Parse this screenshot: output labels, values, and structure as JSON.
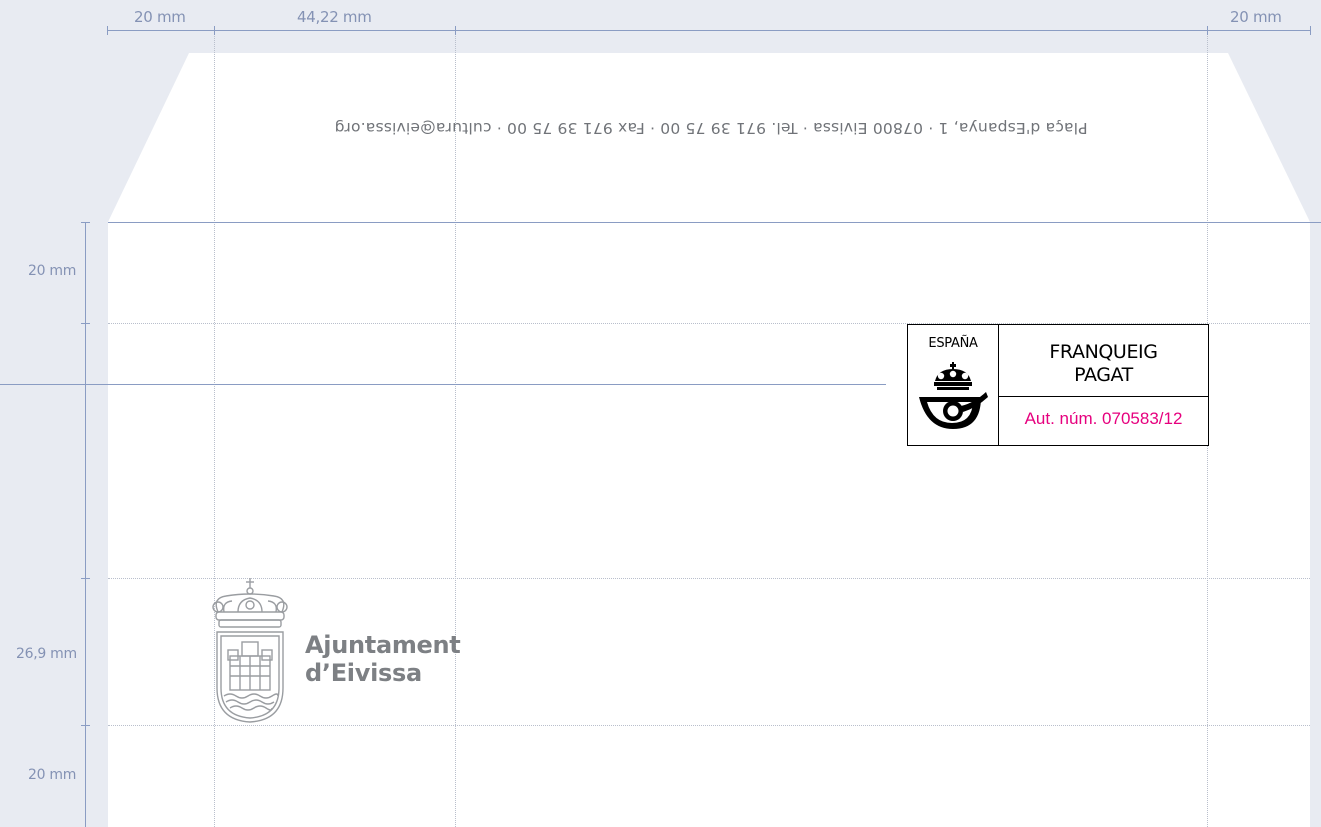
{
  "dimensions": {
    "top_left_margin": "20 mm",
    "top_logo_width": "44,22 mm",
    "top_right_margin": "20 mm",
    "side_top_margin": "20 mm",
    "side_logo_height": "26,9 mm",
    "side_bottom_margin": "20 mm"
  },
  "flap": {
    "address_line": "Plaça d'Espanya, 1 · 07800 Eivissa · Tel. 971 39 75 00 · Fax 971 39 75 00 · cultura@eivissa.org"
  },
  "postage": {
    "country": "ESPAÑA",
    "label_line1": "FRANQUEIG",
    "label_line2": "PAGAT",
    "authorization": "Aut. núm. 070583/12",
    "accent_color": "#e6007e",
    "icon": "correos-crown-horn-icon"
  },
  "logo": {
    "icon": "coat-of-arms-icon",
    "name_line1": "Ajuntament",
    "name_line2": "d’Eivissa",
    "color": "#7d8084"
  },
  "colors": {
    "background": "#e8ebf2",
    "dimension_lines": "#8a9cc3",
    "guide_lines": "#b9bfcc"
  }
}
